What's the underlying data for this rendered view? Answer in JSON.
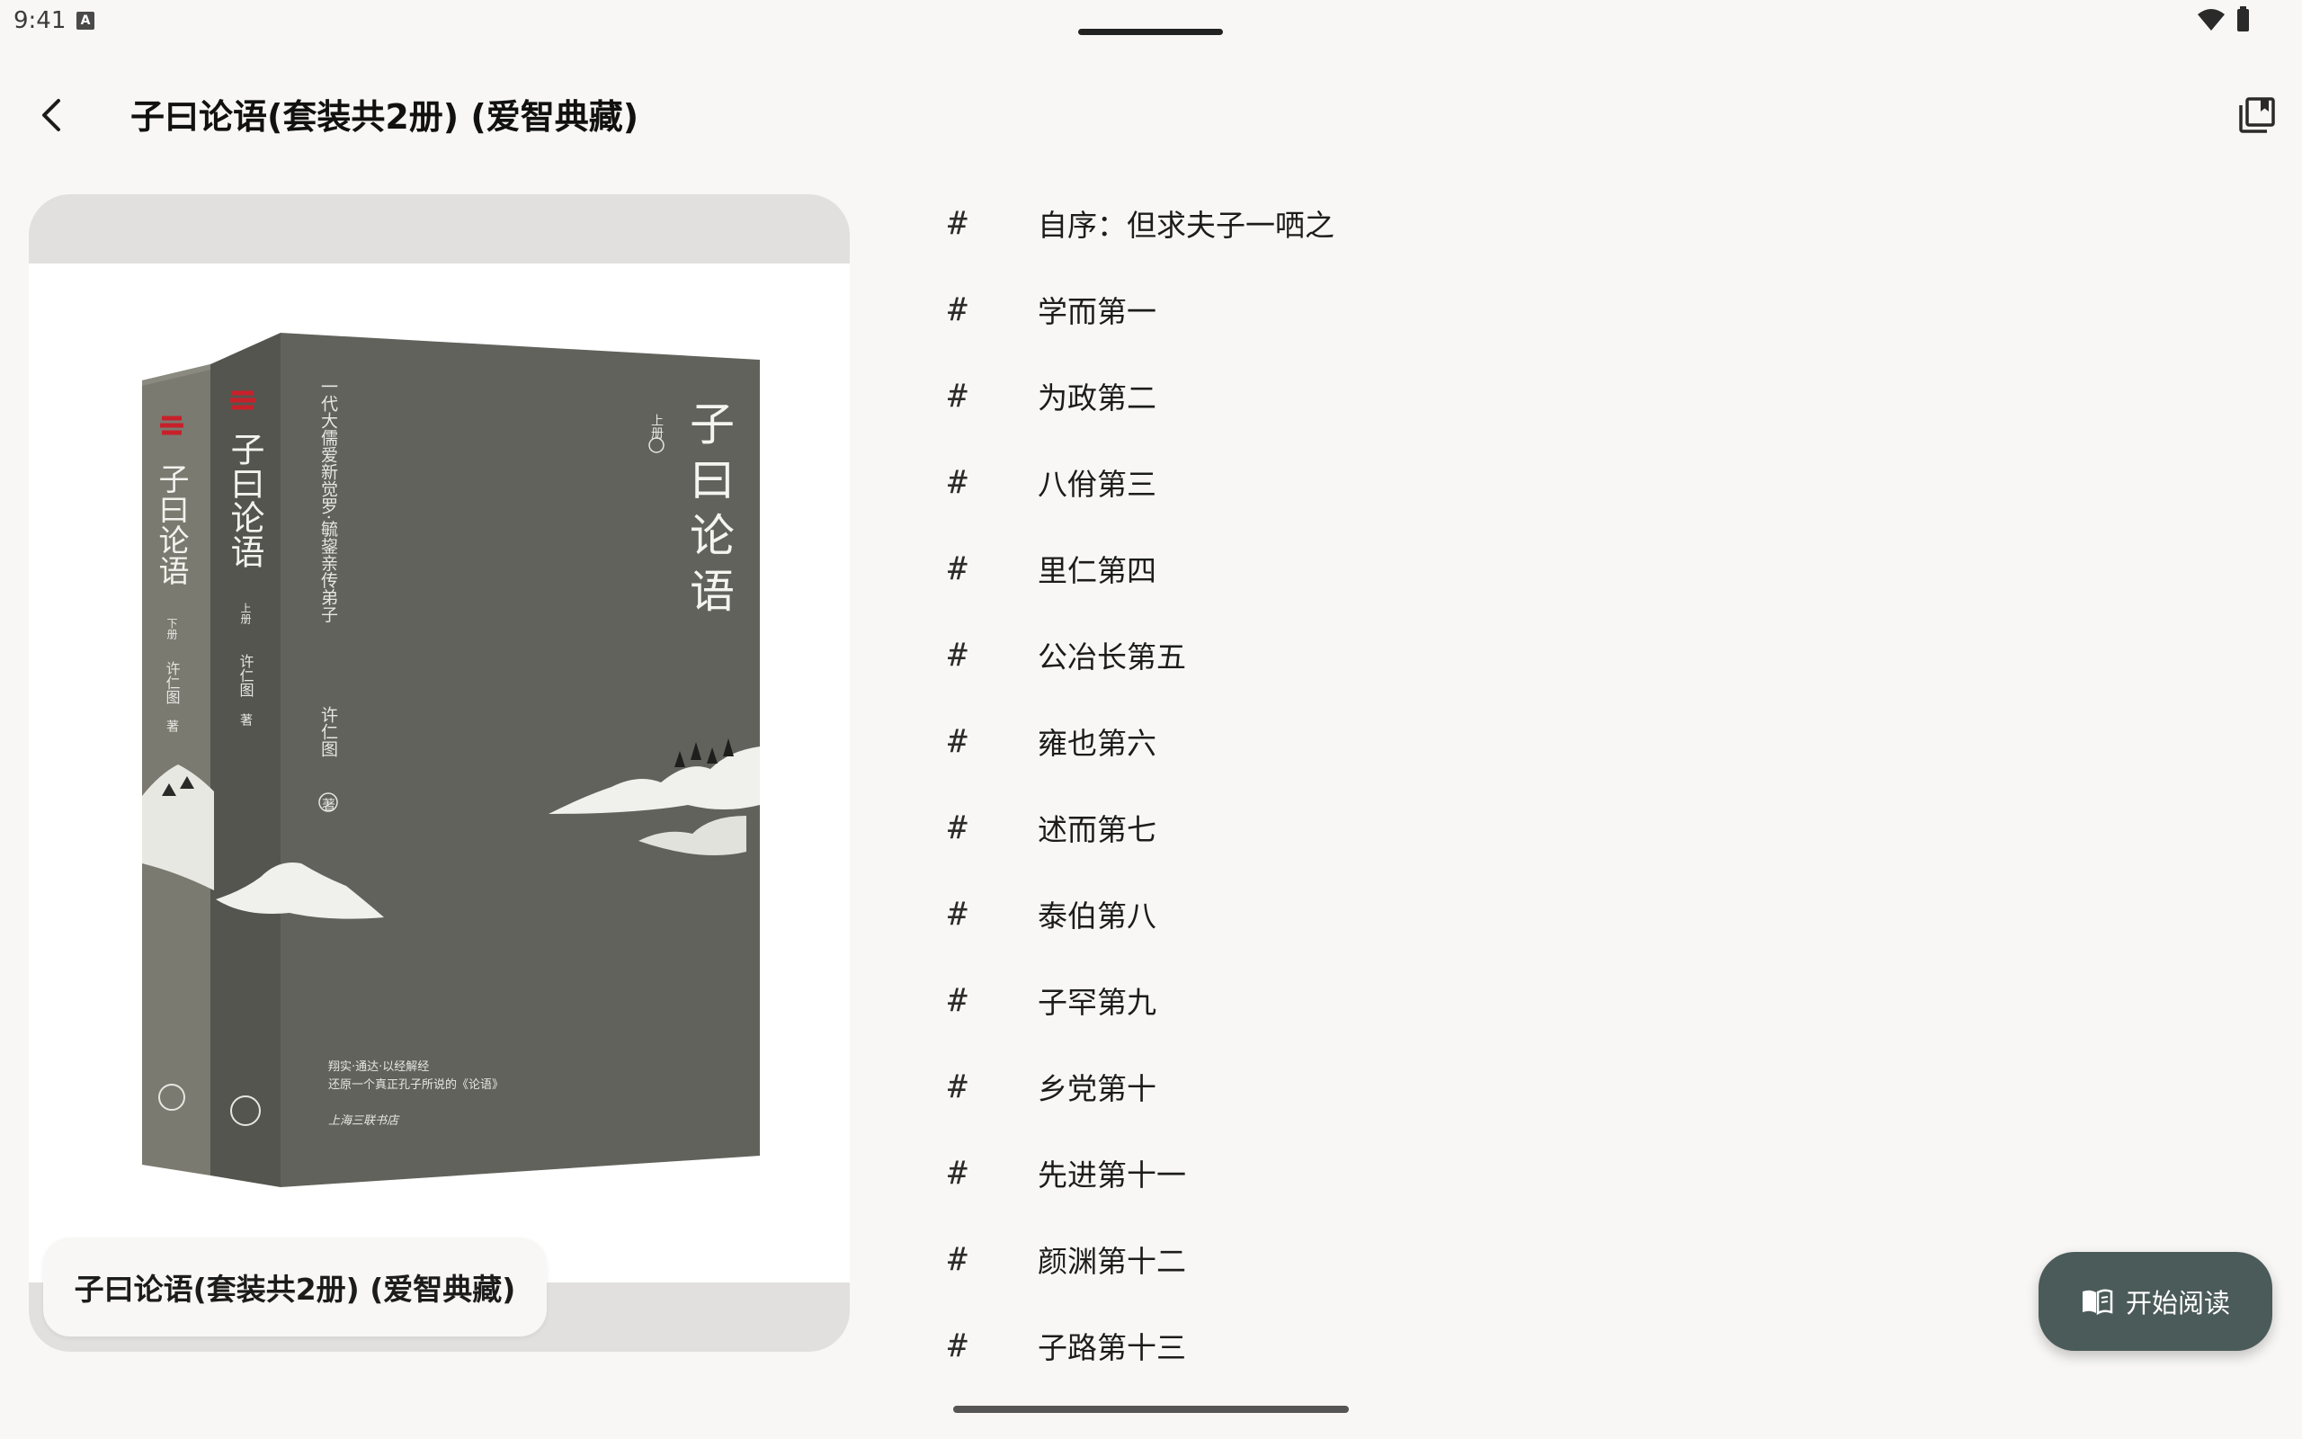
{
  "status_bar": {
    "time": "9:41",
    "notification_icon": "A"
  },
  "app_bar": {
    "title": "子曰论语(套装共2册) (爱智典藏)",
    "back_icon": "arrow-back-icon",
    "bookshelf_icon": "library-books-icon"
  },
  "cover": {
    "caption": "子曰论语(套装共2册) (爱智典藏)",
    "front_title": "子曰论语",
    "front_volume": "上册",
    "front_subtitle": "一代大儒爱新觉罗·毓鋆亲传弟子",
    "front_author": "许仁图",
    "front_author_suffix": "著",
    "front_tagline_1": "翔实·通达·以经解经",
    "front_tagline_2": "还原一个真正孔子所说的《论语》",
    "front_publisher": "上海三联书店",
    "spine1_title": "子曰论语",
    "spine1_volume": "上册",
    "spine1_author": "许仁图",
    "spine1_author_suffix": "著",
    "spine2_title": "子曰论语",
    "spine2_volume": "下册",
    "spine2_author": "许仁图",
    "spine2_author_suffix": "著"
  },
  "chapters": [
    {
      "hash": "#",
      "label": "自序：但求夫子一哂之"
    },
    {
      "hash": "#",
      "label": "学而第一"
    },
    {
      "hash": "#",
      "label": "为政第二"
    },
    {
      "hash": "#",
      "label": "八佾第三"
    },
    {
      "hash": "#",
      "label": "里仁第四"
    },
    {
      "hash": "#",
      "label": "公冶长第五"
    },
    {
      "hash": "#",
      "label": "雍也第六"
    },
    {
      "hash": "#",
      "label": "述而第七"
    },
    {
      "hash": "#",
      "label": "泰伯第八"
    },
    {
      "hash": "#",
      "label": "子罕第九"
    },
    {
      "hash": "#",
      "label": "乡党第十"
    },
    {
      "hash": "#",
      "label": "先进第十一"
    },
    {
      "hash": "#",
      "label": "颜渊第十二"
    },
    {
      "hash": "#",
      "label": "子路第十三"
    }
  ],
  "fab": {
    "label": "开始阅读",
    "icon": "open-book-icon"
  },
  "colors": {
    "background": "#f8f7f5",
    "fab": "#4b5b5a",
    "book_cover": "#5f5f5b",
    "book_spine": "#555550",
    "brand_red": "#c8202a"
  }
}
